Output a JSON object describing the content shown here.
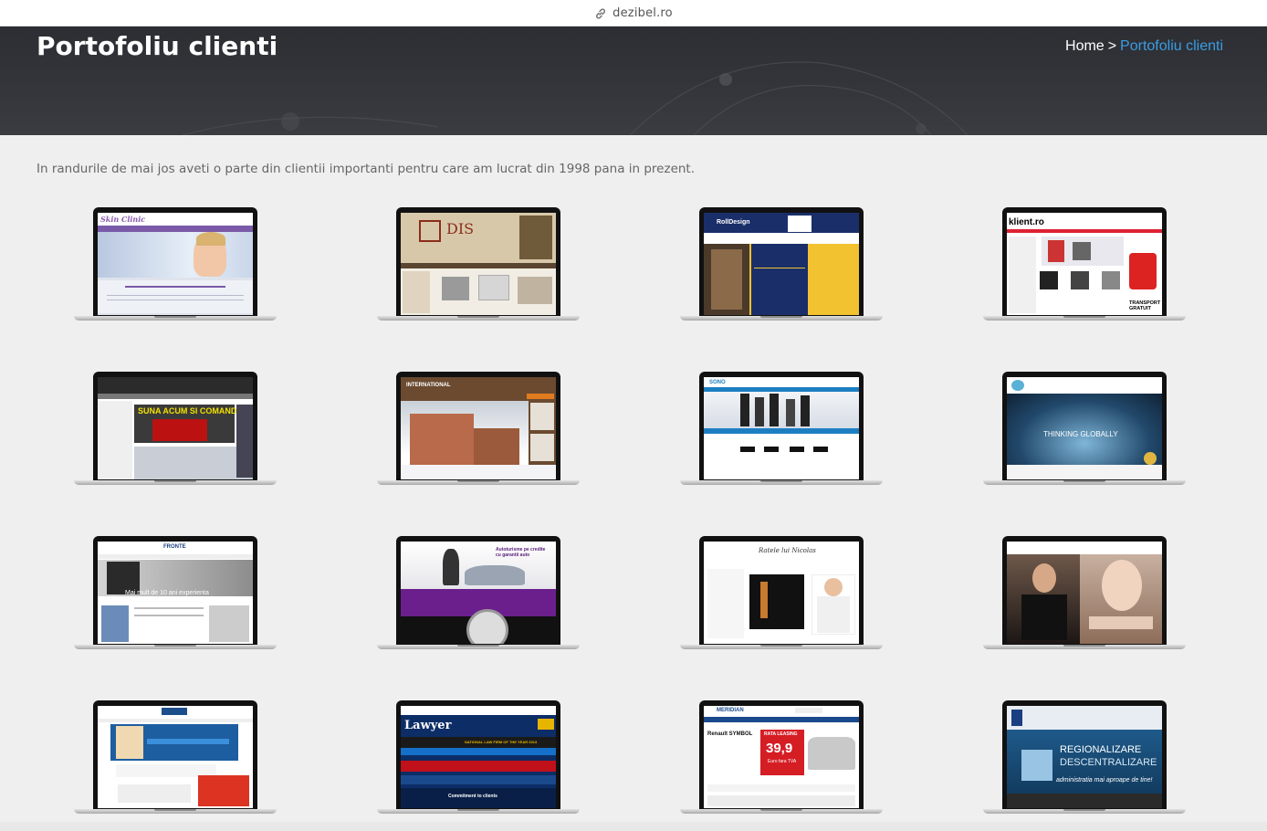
{
  "browser": {
    "url": "dezibel.ro",
    "link_icon": "link-icon"
  },
  "header": {
    "title": "Portofoliu clienti",
    "breadcrumb": {
      "home": "Home",
      "separator": ">",
      "current": "Portofoliu clienti"
    }
  },
  "intro": "In randurile de mai jos aveti o parte din clientii importanti pentru care am lucrat din 1998 pana in prezent.",
  "colors": {
    "accent": "#3b9ce4",
    "hero_bg": "#33353a",
    "page_bg": "#efefef"
  },
  "portfolio": [
    {
      "label": "Skin Clinic"
    },
    {
      "label": "DIS"
    },
    {
      "label": "RollDesign"
    },
    {
      "label": "klient.ro",
      "badge": "TRANSPORT GRATUIT"
    },
    {
      "label": "SUNA ACUM SI COMANDA"
    },
    {
      "label": "INTERNATIONAL"
    },
    {
      "label": "SONO"
    },
    {
      "label": "THINKING GLOBALLY"
    },
    {
      "label": "FRONTE",
      "slogan": "Mai mult de 10 ani experienta"
    },
    {
      "label": "Autoturisme pe credite cu garantii auto"
    },
    {
      "label": "Ratele lui Nicolas"
    },
    {
      "label": ""
    },
    {
      "label": ""
    },
    {
      "label": "Lawyer",
      "sub": "NATIONAL LAW FIRM OF THE YEAR 2013",
      "footer": "Commitment to clients"
    },
    {
      "label": "MERIDIAN",
      "model": "Renault SYMBOL",
      "promo": "RATA LEASING",
      "price": "39,9",
      "price_note": "Euro fara TVA"
    },
    {
      "label": "REGIONALIZARE",
      "sub": "DESCENTRALIZARE",
      "tagline": "administratia mai aproape de tine!"
    }
  ]
}
